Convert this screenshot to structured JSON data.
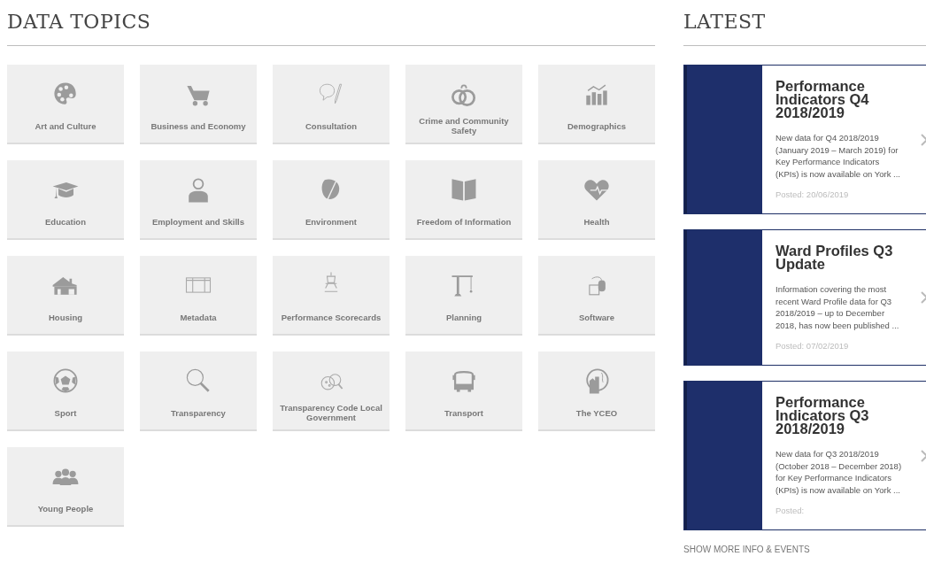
{
  "topics_section": {
    "heading": "DATA TOPICS",
    "topics": [
      {
        "label": "Art and Culture"
      },
      {
        "label": "Business and Economy"
      },
      {
        "label": "Consultation"
      },
      {
        "label": "Crime and Community Safety"
      },
      {
        "label": "Demographics"
      },
      {
        "label": "Education"
      },
      {
        "label": "Employment and Skills"
      },
      {
        "label": "Environment"
      },
      {
        "label": "Freedom of Information"
      },
      {
        "label": "Health"
      },
      {
        "label": "Housing"
      },
      {
        "label": "Metadata"
      },
      {
        "label": "Performance Scorecards"
      },
      {
        "label": "Planning"
      },
      {
        "label": "Software"
      },
      {
        "label": "Sport"
      },
      {
        "label": "Transparency"
      },
      {
        "label": "Transparency Code Local Government"
      },
      {
        "label": "Transport"
      },
      {
        "label": "The YCEO"
      },
      {
        "label": "Young People"
      }
    ]
  },
  "latest_section": {
    "heading": "LATEST",
    "posts": [
      {
        "title": "Performance Indicators Q4 2018/2019",
        "summary": "New data for Q4 2018/2019 (January 2019 – March 2019) for Key Performance Indicators (KPIs) is now available on York ...",
        "posted": "Posted: 20/06/2019"
      },
      {
        "title": "Ward Profiles Q3 Update",
        "summary": "Information covering the most recent Ward Profile data for Q3 2018/2019 – up to December 2018, has now been published ...",
        "posted": "Posted: 07/02/2019"
      },
      {
        "title": "Performance Indicators Q3 2018/2019",
        "summary": "New data for Q3 2018/2019 (October 2018 – December 2018) for Key Performance Indicators (KPIs) is now available on York ...",
        "posted": "Posted:"
      }
    ],
    "more_link": "SHOW MORE INFO & EVENTS"
  }
}
